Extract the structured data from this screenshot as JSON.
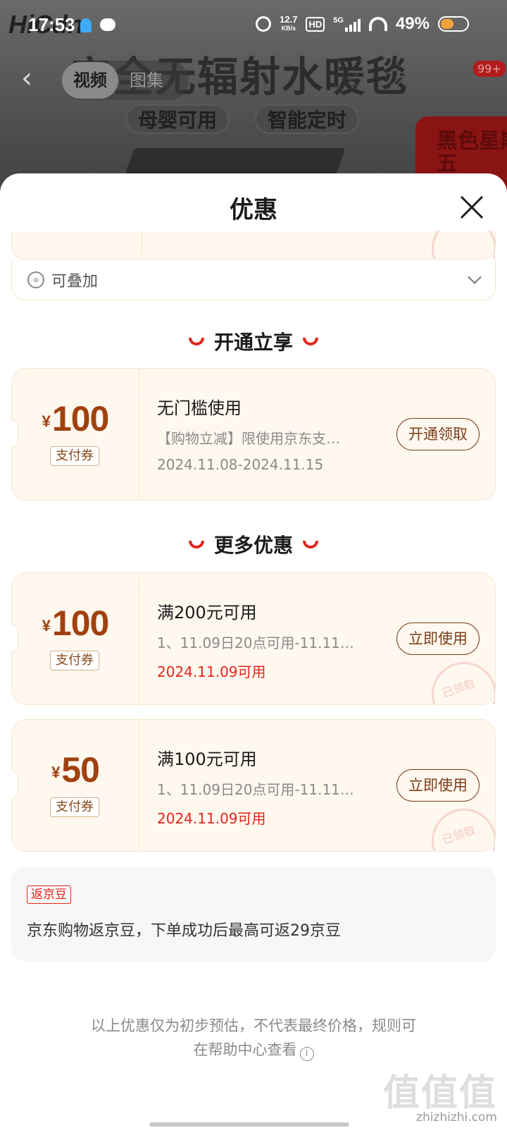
{
  "status_bar": {
    "time": "17:53",
    "network_speed": "12.7",
    "network_speed_unit": "KB/s",
    "hd_label": "HD",
    "signal_label": "5G",
    "battery_percent": "49%"
  },
  "background_page": {
    "product_title": "安全无辐射水暖毯",
    "media_tabs": [
      "视频",
      "图集"
    ],
    "feature_chips": [
      "母婴可用",
      "智能定时"
    ],
    "cart_badge": "99+",
    "promo_tag": "黑色星期五"
  },
  "sheet": {
    "title": "优惠",
    "stackable_label": "可叠加",
    "stamp_text": "已领取",
    "sections": {
      "open_title": "开通立享",
      "more_title": "更多优惠"
    },
    "coupons_open": [
      {
        "currency": "¥",
        "amount": "100",
        "type": "支付券",
        "condition": "无门槛使用",
        "desc": "【购物立减】限使用京东支…",
        "validity": "2024.11.08-2024.11.15",
        "button": "开通领取"
      }
    ],
    "coupons_more": [
      {
        "currency": "¥",
        "amount": "100",
        "type": "支付券",
        "condition": "满200元可用",
        "desc": "1、11.09日20点可用-11.11…",
        "validity": "2024.11.09可用",
        "button": "立即使用"
      },
      {
        "currency": "¥",
        "amount": "50",
        "type": "支付券",
        "condition": "满100元可用",
        "desc": "1、11.09日20点可用-11.11…",
        "validity": "2024.11.09可用",
        "button": "立即使用"
      }
    ],
    "jd_beans": {
      "tag": "返京豆",
      "text": "京东购物返京豆，下单成功后最高可返29京豆"
    },
    "footnote_line1": "以上优惠仅为初步预估，不代表最终价格，规则可",
    "footnote_line2": "在帮助中心查看"
  },
  "watermark": {
    "logo": "值值值",
    "url": "zhizhizhi.com"
  },
  "colors": {
    "accent_red": "#e1251b",
    "coupon_brown": "#a0410e",
    "coupon_bg": "#fff8ef"
  }
}
